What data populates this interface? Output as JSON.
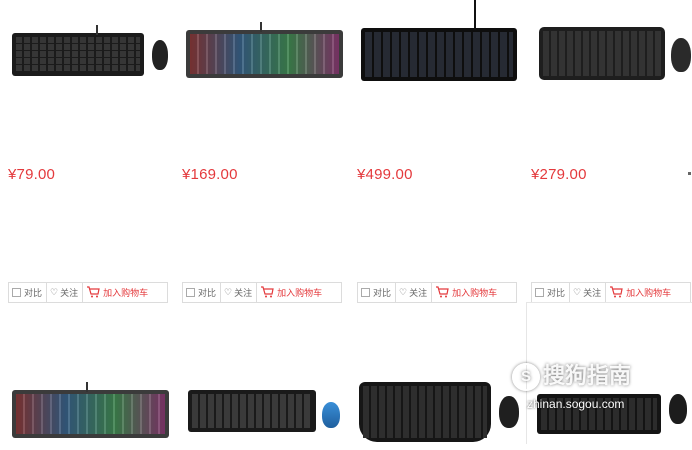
{
  "products": [
    {
      "price": "¥79.00",
      "compare": "对比",
      "follow": "关注",
      "cart": "加入购物车"
    },
    {
      "price": "¥169.00",
      "compare": "对比",
      "follow": "关注",
      "cart": "加入购物车"
    },
    {
      "price": "¥499.00",
      "compare": "对比",
      "follow": "关注",
      "cart": "加入购物车"
    },
    {
      "price": "¥279.00",
      "compare": "对比",
      "follow": "关注",
      "cart": "加入购物车"
    }
  ],
  "watermark": {
    "brand": "搜狗指南",
    "url": "zhinan.sogou.com"
  },
  "colors": {
    "price": "#e4393c",
    "border": "#dcdcdc",
    "text": "#666666"
  },
  "icons": [
    "checkbox-icon",
    "heart-icon",
    "cart-icon",
    "sogou-logo-icon"
  ]
}
